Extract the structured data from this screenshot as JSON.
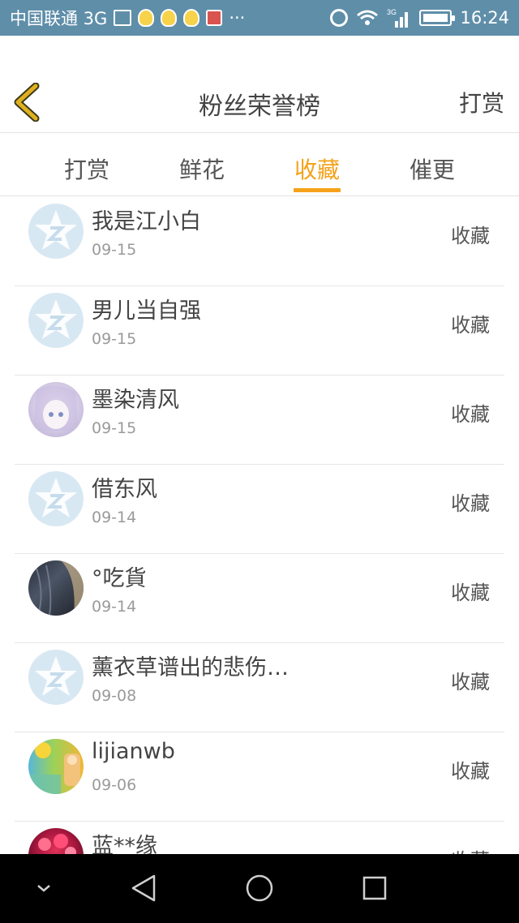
{
  "status_bar": {
    "carrier": "中国联通 3G",
    "network_label": "3G",
    "time": "16:24",
    "icons": [
      "picture-icon",
      "bulb-icon",
      "bulb-icon",
      "bulb-icon",
      "app-icon",
      "more-dots",
      "alarm-icon",
      "wifi-icon",
      "signal-icon",
      "battery-icon"
    ]
  },
  "header": {
    "title": "粉丝荣誉榜",
    "action_label": "打赏",
    "back_icon": "chevron-left-icon"
  },
  "tabs": [
    {
      "label": "打赏",
      "active": false
    },
    {
      "label": "鲜花",
      "active": false
    },
    {
      "label": "收藏",
      "active": true
    },
    {
      "label": "催更",
      "active": false
    }
  ],
  "list": {
    "items": [
      {
        "name": "我是江小白",
        "date": "09-15",
        "action": "收藏",
        "avatar": "default"
      },
      {
        "name": "男儿当自强",
        "date": "09-15",
        "action": "收藏",
        "avatar": "default"
      },
      {
        "name": "墨染清风",
        "date": "09-15",
        "action": "收藏",
        "avatar": "anime"
      },
      {
        "name": "借东风",
        "date": "09-14",
        "action": "收藏",
        "avatar": "default"
      },
      {
        "name": "°吃貨",
        "date": "09-14",
        "action": "收藏",
        "avatar": "dark"
      },
      {
        "name": "薰衣草谱出的悲伤…",
        "date": "09-08",
        "action": "收藏",
        "avatar": "default"
      },
      {
        "name": "lijianwb",
        "date": "09-06",
        "action": "收藏",
        "avatar": "colorful"
      },
      {
        "name": "蓝**缘",
        "date": "",
        "action": "收藏",
        "avatar": "flowers"
      }
    ]
  },
  "colors": {
    "status_bar": "#5f8ea9",
    "accent": "#f5a21a",
    "back_arrow": "#e0b020",
    "default_avatar": "#d8e8f3"
  },
  "nav_bar": {
    "icons": [
      "hide-keyboard-icon",
      "back-triangle-icon",
      "home-circle-icon",
      "recents-square-icon"
    ]
  }
}
